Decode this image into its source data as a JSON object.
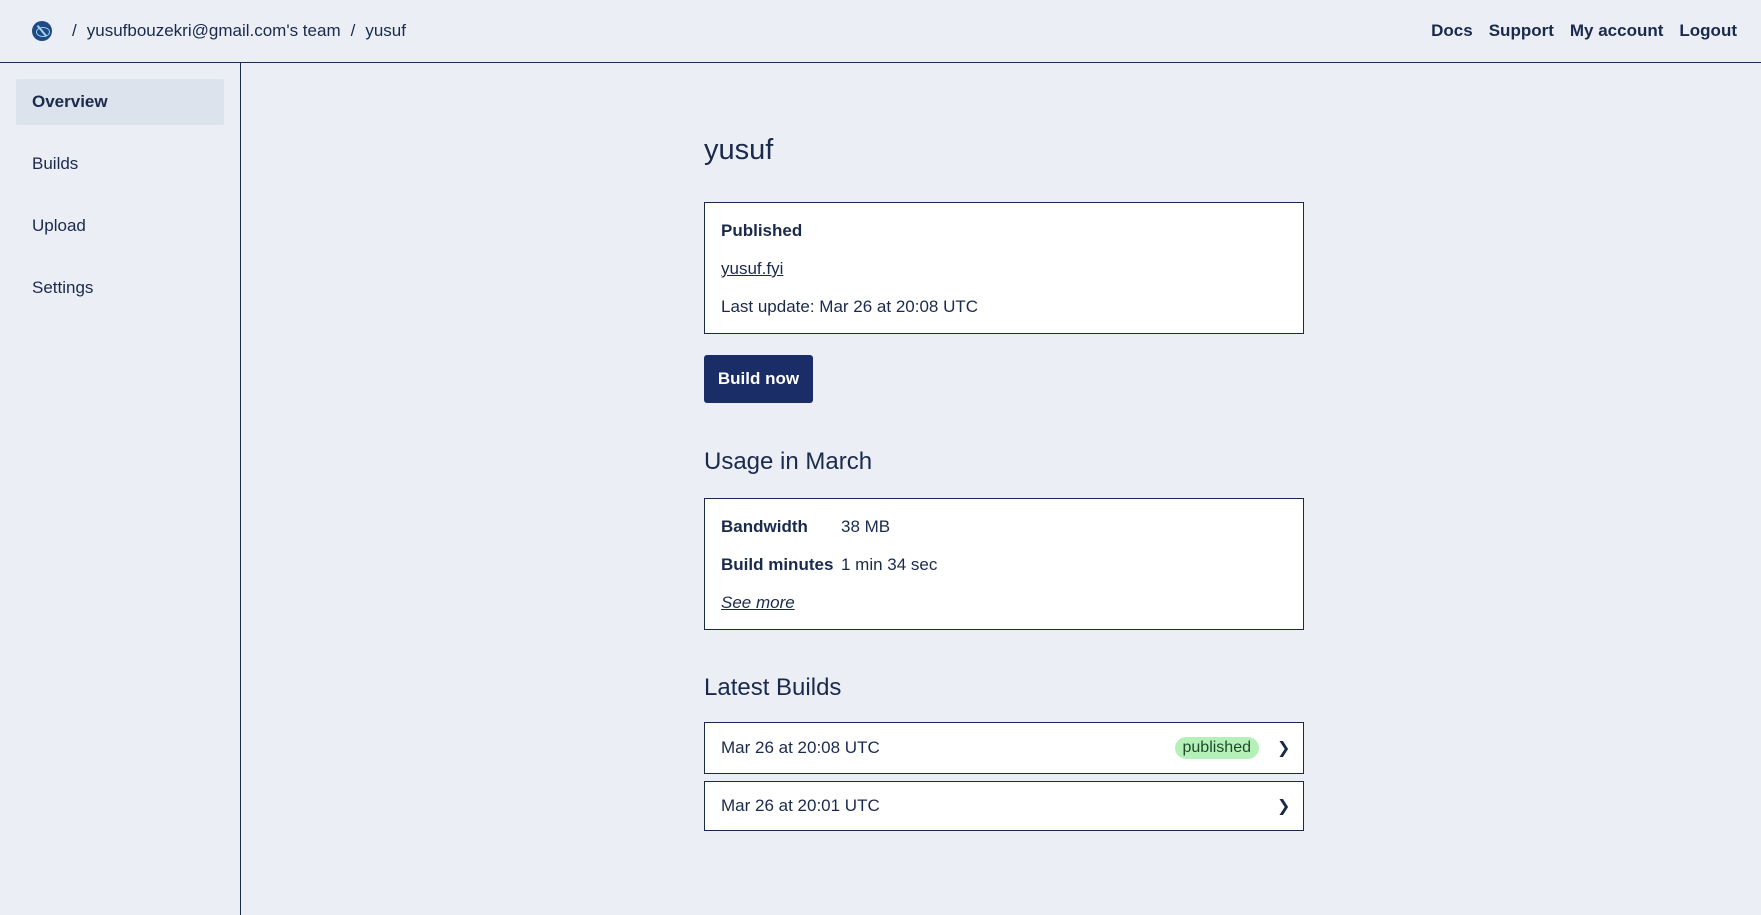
{
  "header": {
    "breadcrumbs": [
      "yusufbouzekri@gmail.com's team",
      "yusuf"
    ],
    "separator": "/",
    "nav": [
      "Docs",
      "Support",
      "My account",
      "Logout"
    ]
  },
  "sidebar": {
    "items": [
      {
        "label": "Overview",
        "active": true
      },
      {
        "label": "Builds",
        "active": false
      },
      {
        "label": "Upload",
        "active": false
      },
      {
        "label": "Settings",
        "active": false
      }
    ]
  },
  "main": {
    "title": "yusuf",
    "published": {
      "heading": "Published",
      "url": "yusuf.fyi",
      "last_update": "Last update: Mar 26 at 20:08 UTC"
    },
    "build_button": "Build now",
    "usage": {
      "title": "Usage in March",
      "rows": [
        {
          "key": "Bandwidth",
          "value": "38 MB"
        },
        {
          "key": "Build minutes",
          "value": "1 min 34 sec"
        }
      ],
      "see_more": "See more"
    },
    "latest_builds": {
      "title": "Latest Builds",
      "items": [
        {
          "date": "Mar 26 at 20:08 UTC",
          "badge": "published"
        },
        {
          "date": "Mar 26 at 20:01 UTC",
          "badge": ""
        }
      ]
    }
  },
  "colors": {
    "background": "#ebeff5",
    "text": "#1a2a4d",
    "button": "#1a2d66",
    "badge_bg": "#b6f0b9"
  }
}
